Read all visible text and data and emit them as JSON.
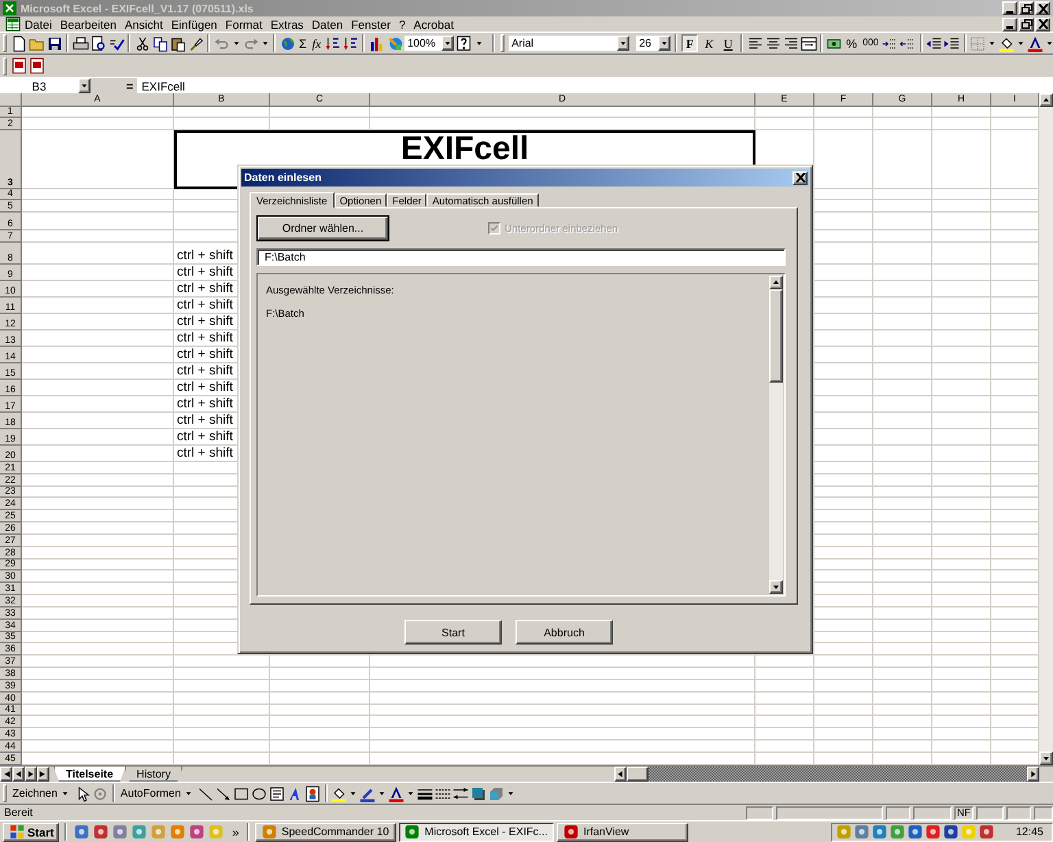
{
  "window": {
    "title": "Microsoft Excel - EXIFcell_V1.17 (070511).xls"
  },
  "menu": [
    "Datei",
    "Bearbeiten",
    "Ansicht",
    "Einfügen",
    "Format",
    "Extras",
    "Daten",
    "Fenster",
    "?",
    "Acrobat"
  ],
  "standard_toolbar": {
    "sum": "Σ",
    "function": "fx",
    "zoom": "100%"
  },
  "format_toolbar": {
    "font": "Arial",
    "font_size": "26",
    "styles": [
      {
        "label": "F",
        "kind": "bold",
        "pressed": true
      },
      {
        "label": "K",
        "kind": "italic",
        "pressed": false
      },
      {
        "label": "U",
        "kind": "underline",
        "pressed": false
      }
    ],
    "percent": "%",
    "thousands": "000"
  },
  "formula_bar": {
    "name_box": "B3",
    "equals": "=",
    "content": "EXIFcell"
  },
  "sheet": {
    "columns": [
      "A",
      "B",
      "C",
      "D",
      "E",
      "F",
      "G",
      "H",
      "I"
    ],
    "rows": [
      {
        "number": "1"
      },
      {
        "number": "2"
      },
      {
        "number": "3",
        "cell_b": "EXIFcell"
      },
      {
        "number": "4"
      },
      {
        "number": "5"
      },
      {
        "number": "6"
      },
      {
        "number": "7"
      },
      {
        "number": "8",
        "cell_b": "ctrl + shift"
      },
      {
        "number": "9",
        "cell_b": "ctrl + shift"
      },
      {
        "number": "10",
        "cell_b": "ctrl + shift"
      },
      {
        "number": "11",
        "cell_b": "ctrl + shift"
      },
      {
        "number": "12",
        "cell_b": "ctrl + shift"
      },
      {
        "number": "13",
        "cell_b": "ctrl + shift"
      },
      {
        "number": "14",
        "cell_b": "ctrl + shift"
      },
      {
        "number": "15",
        "cell_b": "ctrl + shift"
      },
      {
        "number": "16",
        "cell_b": "ctrl + shift"
      },
      {
        "number": "17",
        "cell_b": "ctrl + shift"
      },
      {
        "number": "18",
        "cell_b": "ctrl + shift"
      },
      {
        "number": "19",
        "cell_b": "ctrl + shift"
      },
      {
        "number": "20",
        "cell_b": "ctrl + shift"
      },
      {
        "number": "21"
      },
      {
        "number": "22"
      },
      {
        "number": "23"
      },
      {
        "number": "24"
      },
      {
        "number": "25"
      },
      {
        "number": "26"
      },
      {
        "number": "27"
      },
      {
        "number": "28"
      },
      {
        "number": "29"
      },
      {
        "number": "30"
      },
      {
        "number": "31"
      },
      {
        "number": "32"
      },
      {
        "number": "33"
      },
      {
        "number": "34"
      },
      {
        "number": "35"
      },
      {
        "number": "36"
      },
      {
        "number": "37"
      },
      {
        "number": "38"
      },
      {
        "number": "39"
      },
      {
        "number": "40"
      },
      {
        "number": "41"
      },
      {
        "number": "42"
      },
      {
        "number": "43"
      },
      {
        "number": "44"
      },
      {
        "number": "45"
      }
    ]
  },
  "dialog": {
    "title": "Daten einlesen",
    "tabs": [
      {
        "label": "Verzeichnisliste",
        "selected": true
      },
      {
        "label": "Optionen",
        "selected": false
      },
      {
        "label": "Felder",
        "selected": false
      },
      {
        "label": "Automatisch ausfüllen",
        "selected": false
      }
    ],
    "folder_button": "Ordner wählen...",
    "subfolders": {
      "label": "Unterordner einbeziehen",
      "checked": true,
      "disabled": true
    },
    "path": "F:\\Batch",
    "list_heading": "Ausgewählte Verzeichnisse:",
    "list_items": [
      "F:\\Batch"
    ],
    "buttons": [
      "Start",
      "Abbruch"
    ]
  },
  "sheet_tabs": [
    {
      "label": "Titelseite",
      "selected": true
    },
    {
      "label": "History",
      "selected": false
    }
  ],
  "drawing_toolbar": {
    "draw": "Zeichnen",
    "autoshapes": "AutoFormen"
  },
  "status_bar": {
    "status": "Bereit",
    "indicators": [
      "NF"
    ]
  },
  "taskbar": {
    "start": "Start",
    "more": "»",
    "tasks": [
      {
        "label": "SpeedCommander 10",
        "selected": false
      },
      {
        "label": "Microsoft Excel - EXIFc...",
        "selected": true
      },
      {
        "label": "IrfanView",
        "selected": false
      }
    ],
    "clock": "12:45"
  }
}
